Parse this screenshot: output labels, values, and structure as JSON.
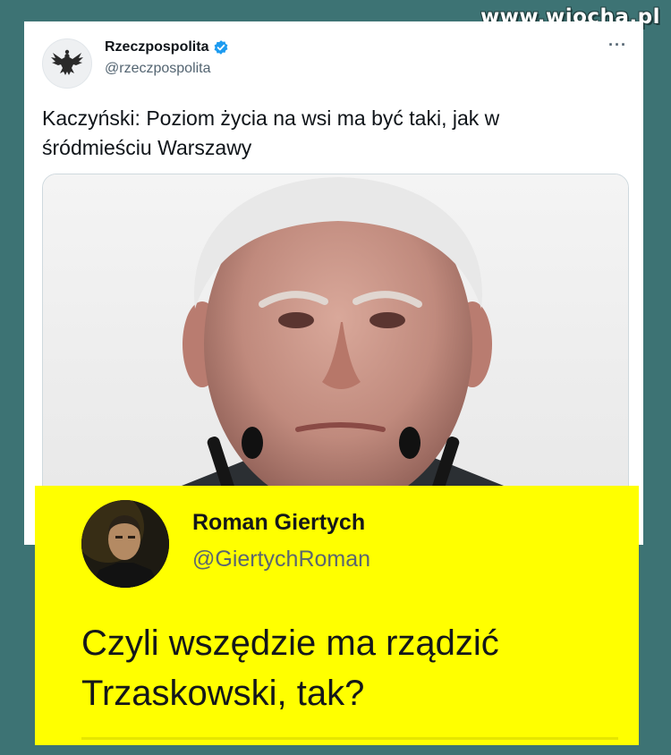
{
  "watermark": "www.wiocha.pl",
  "tweet": {
    "author_name": "Rzeczpospolita",
    "author_handle": "@rzeczpospolita",
    "verified_icon": "verified-badge-icon",
    "avatar_icon": "eagle-logo-icon",
    "more_icon": "more-options-icon",
    "more_glyph": "···",
    "text": "Kaczyński: Poziom życia na wsi ma być taki, jak w śródmieściu Warszawy",
    "media_alt": "photo-of-man-at-microphones"
  },
  "reply": {
    "author_name": "Roman Giertych",
    "author_handle": "@GiertychRoman",
    "text_line1": "Czyli wszędzie ma rządzić",
    "text_line2": "Trzaskowski, tak?"
  },
  "colors": {
    "background": "#3d7374",
    "overlay": "#ffff00",
    "verified": "#1d9bf0"
  }
}
